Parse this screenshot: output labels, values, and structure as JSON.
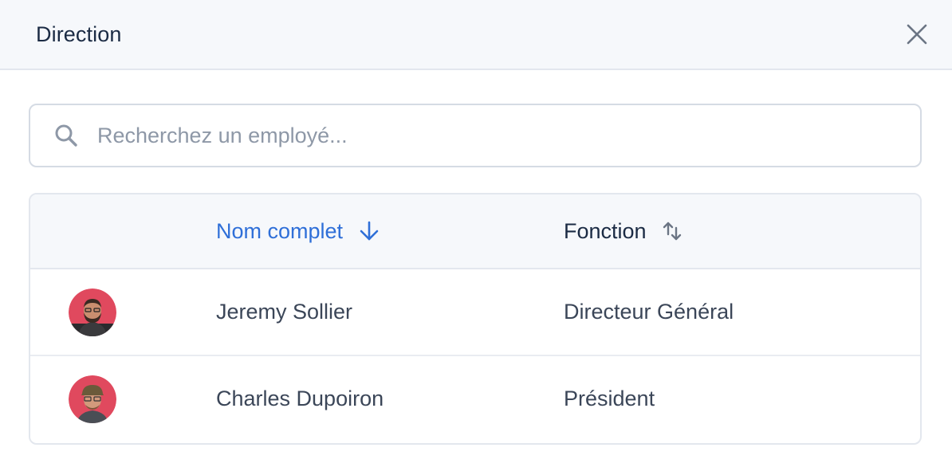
{
  "modal": {
    "title": "Direction",
    "close_icon": "close-icon"
  },
  "search": {
    "placeholder": "Recherchez un employé...",
    "value": "",
    "icon": "search-icon"
  },
  "table": {
    "columns": [
      {
        "label": "Nom complet",
        "sort": "descending",
        "icon": "arrow-down-icon",
        "active": true,
        "color": "#2f6fd8"
      },
      {
        "label": "Fonction",
        "sort": "none",
        "icon": "sort-icon",
        "active": false,
        "color": "#1b2b44"
      }
    ],
    "rows": [
      {
        "avatar": "avatar-jeremy",
        "name": "Jeremy Sollier",
        "role": "Directeur Général"
      },
      {
        "avatar": "avatar-charles",
        "name": "Charles Dupoiron",
        "role": "Président"
      }
    ]
  },
  "colors": {
    "accent": "#2f6fd8",
    "header_bg": "#f6f8fb",
    "border": "#e3e7ee",
    "avatar_bg": "#e0495e"
  }
}
